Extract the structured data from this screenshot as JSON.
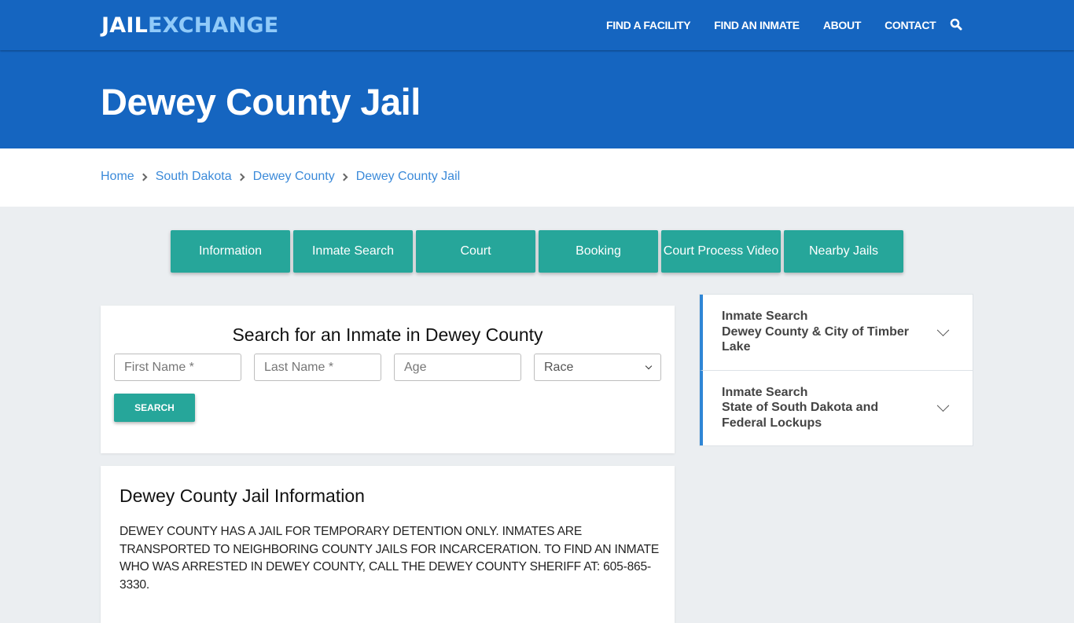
{
  "header": {
    "logo_part1": "JAIL",
    "logo_part2": "EXCHANGE",
    "nav": [
      "FIND A FACILITY",
      "FIND AN INMATE",
      "ABOUT",
      "CONTACT"
    ],
    "search_icon": "search-icon"
  },
  "hero": {
    "title": "Dewey County Jail"
  },
  "breadcrumb": [
    "Home",
    "South Dakota",
    "Dewey County",
    "Dewey County Jail"
  ],
  "tabs": [
    "Information",
    "Inmate Search",
    "Court",
    "Booking",
    "Court Process Video",
    "Nearby Jails"
  ],
  "search_form": {
    "title": "Search for an Inmate in Dewey County",
    "first_name_placeholder": "First Name *",
    "last_name_placeholder": "Last Name *",
    "age_placeholder": "Age",
    "race_selected": "Race",
    "submit_label": "SEARCH"
  },
  "info": {
    "title": "Dewey County Jail Information",
    "body": "DEWEY COUNTY HAS A JAIL FOR TEMPORARY DETENTION ONLY.  INMATES ARE TRANSPORTED TO NEIGHBORING COUNTY JAILS FOR INCARCERATION.  TO FIND AN INMATE WHO WAS ARRESTED IN DEWEY COUNTY, CALL THE DEWEY COUNTY SHERIFF AT: 605-865-3330."
  },
  "sidebar": {
    "items": [
      {
        "line1": "Inmate Search",
        "line2": "Dewey County & City of Timber Lake"
      },
      {
        "line1": "Inmate Search",
        "line2": "State of South Dakota and Federal Lockups"
      }
    ]
  },
  "colors": {
    "primary": "#1565c0",
    "accent": "#26a69a",
    "logo_accent": "#90caf9",
    "link": "#3b8ad9"
  }
}
